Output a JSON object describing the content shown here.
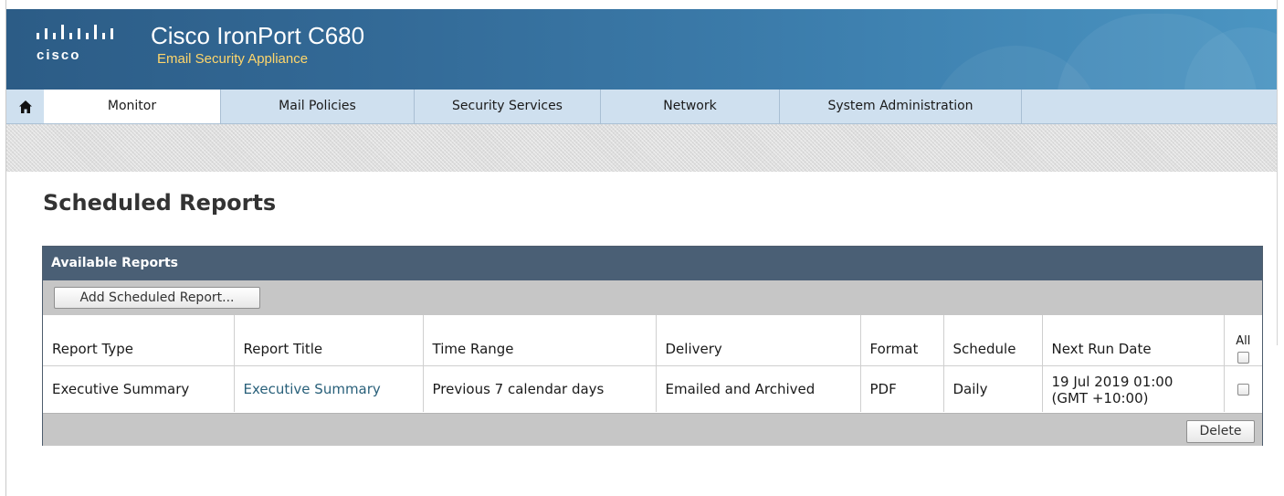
{
  "header": {
    "logo_text": "cisco",
    "product_name": "Cisco IronPort C680",
    "product_subtitle": "Email Security Appliance"
  },
  "nav": {
    "home_icon": "home-icon",
    "tabs": [
      {
        "label": "Monitor",
        "active": true
      },
      {
        "label": "Mail Policies",
        "active": false
      },
      {
        "label": "Security Services",
        "active": false
      },
      {
        "label": "Network",
        "active": false
      },
      {
        "label": "System Administration",
        "active": false
      }
    ]
  },
  "page": {
    "title": "Scheduled Reports"
  },
  "panel": {
    "title": "Available Reports",
    "add_button": "Add Scheduled Report...",
    "delete_button": "Delete",
    "all_label": "All",
    "columns": [
      "Report Type",
      "Report Title",
      "Time Range",
      "Delivery",
      "Format",
      "Schedule",
      "Next Run Date"
    ],
    "rows": [
      {
        "report_type": "Executive Summary",
        "report_title": "Executive Summary",
        "time_range": "Previous 7 calendar days",
        "delivery": "Emailed and Archived",
        "format": "PDF",
        "schedule": "Daily",
        "next_run_date": "19 Jul 2019 01:00",
        "next_run_tz": "(GMT +10:00)",
        "checked": false
      }
    ]
  },
  "colors": {
    "header_blue": "#336a97",
    "nav_bg": "#cfe0ef",
    "panel_header": "#4a5f75",
    "link": "#29607a",
    "subtitle_yellow": "#ffd66b"
  }
}
